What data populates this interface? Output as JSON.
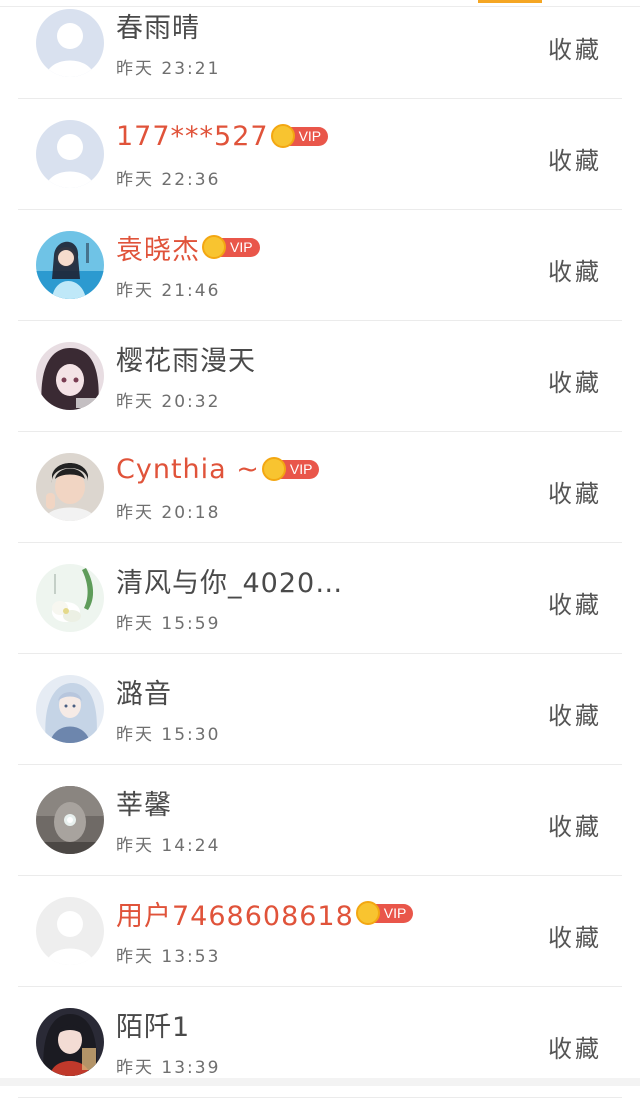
{
  "colors": {
    "accent": "#f5a623",
    "vip_name": "#e0533a",
    "vip_badge": "#e9564a",
    "normal_name": "#4a4a4a"
  },
  "rows": [
    {
      "name": "春雨晴",
      "time": "昨天 23:21",
      "vip": false,
      "vip_label": "",
      "fav": "收藏",
      "avatar": "default"
    },
    {
      "name": "177***527",
      "time": "昨天 22:36",
      "vip": true,
      "vip_label": "VIP",
      "fav": "收藏",
      "avatar": "default"
    },
    {
      "name": "袁晓杰",
      "time": "昨天 21:46",
      "vip": true,
      "vip_label": "VIP",
      "fav": "收藏",
      "avatar": "photo-blue"
    },
    {
      "name": "樱花雨漫天",
      "time": "昨天 20:32",
      "vip": false,
      "vip_label": "",
      "fav": "收藏",
      "avatar": "photo-dark"
    },
    {
      "name": "Cynthia ~",
      "time": "昨天 20:18",
      "vip": true,
      "vip_label": "VIP",
      "fav": "收藏",
      "avatar": "photo-boy"
    },
    {
      "name": "清风与你_4020…",
      "time": "昨天 15:59",
      "vip": false,
      "vip_label": "",
      "fav": "收藏",
      "avatar": "photo-flower"
    },
    {
      "name": "潞音",
      "time": "昨天 15:30",
      "vip": false,
      "vip_label": "",
      "fav": "收藏",
      "avatar": "photo-anime"
    },
    {
      "name": "莘馨",
      "time": "昨天 14:24",
      "vip": false,
      "vip_label": "",
      "fav": "收藏",
      "avatar": "photo-mist"
    },
    {
      "name": "用户7468608618",
      "time": "昨天 13:53",
      "vip": true,
      "vip_label": "VIP",
      "fav": "收藏",
      "avatar": "default-grey"
    },
    {
      "name": "陌阡1",
      "time": "昨天 13:39",
      "vip": false,
      "vip_label": "",
      "fav": "收藏",
      "avatar": "photo-girl"
    }
  ]
}
